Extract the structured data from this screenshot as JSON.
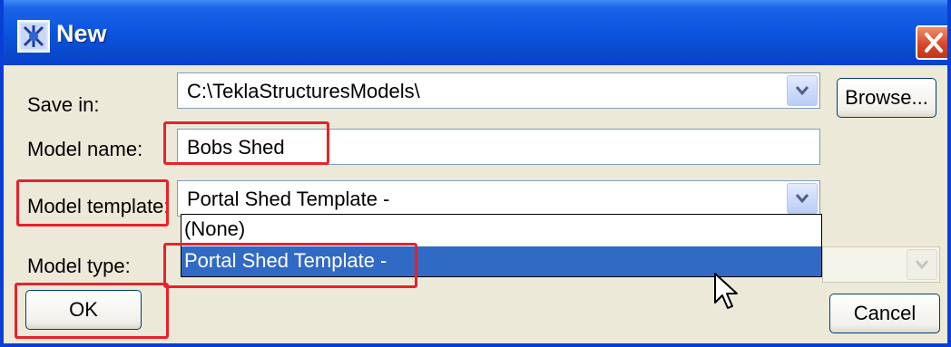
{
  "window": {
    "title": "New"
  },
  "form": {
    "save_in_label": "Save in:",
    "save_in_value": "C:\\TeklaStructuresModels\\",
    "browse_label": "Browse...",
    "model_name_label": "Model name:",
    "model_name_value": "Bobs Shed",
    "model_template_label": "Model template:",
    "model_template_value": "Portal Shed Template -",
    "model_template_options": [
      "(None)",
      "Portal Shed Template -"
    ],
    "model_template_selected_index": 1,
    "model_type_label": "Model type:"
  },
  "buttons": {
    "ok": "OK",
    "cancel": "Cancel"
  },
  "icons": {
    "window_icon": "tekla-app-icon",
    "close": "close-icon",
    "dropdown_arrow": "chevron-down-icon",
    "cursor": "mouse-cursor-icon"
  },
  "colors": {
    "titlebar": "#0a55e0",
    "selection": "#316ac5",
    "highlight": "#e8212a",
    "dialog_bg": "#ece9d8"
  }
}
